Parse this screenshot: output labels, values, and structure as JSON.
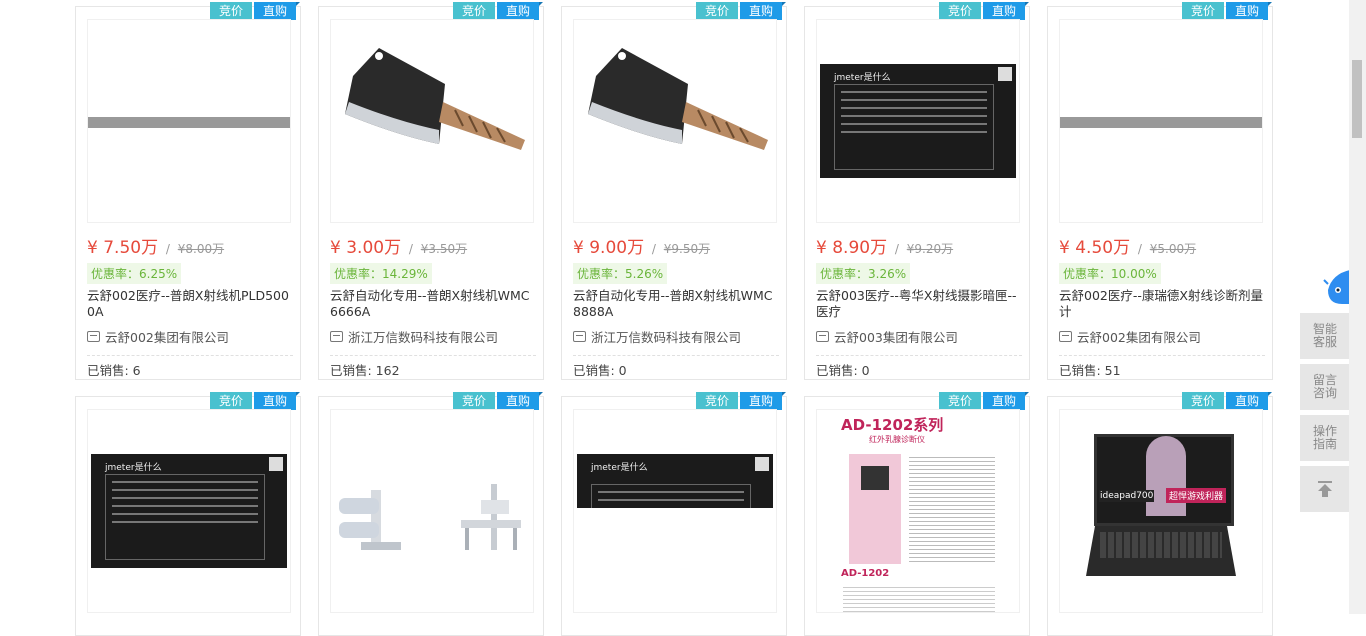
{
  "badges": {
    "bid": "竞价",
    "buy": "直购"
  },
  "labels": {
    "sold_prefix": "已销售: "
  },
  "products": [
    {
      "price": "¥ 7.50万",
      "orig_sep": " / ",
      "orig": "¥8.00万",
      "discount": "优惠率：6.25%",
      "title": "云舒002医疗--普朗X射线机PLD5000A",
      "company": "云舒002集团有限公司",
      "sold": "已销售: 6",
      "image": "gray-placeholder"
    },
    {
      "price": "¥ 3.00万",
      "orig_sep": " / ",
      "orig": "¥3.50万",
      "discount": "优惠率：14.29%",
      "title": "云舒自动化专用--普朗X射线机WMC6666A",
      "company": "浙江万信数码科技有限公司",
      "sold": "已销售: 162",
      "image": "cleaver-knife"
    },
    {
      "price": "¥ 9.00万",
      "orig_sep": " / ",
      "orig": "¥9.50万",
      "discount": "优惠率：5.26%",
      "title": "云舒自动化专用--普朗X射线机WMC8888A",
      "company": "浙江万信数码科技有限公司",
      "sold": "已销售: 0",
      "image": "cleaver-knife"
    },
    {
      "price": "¥ 8.90万",
      "orig_sep": " / ",
      "orig": "¥9.20万",
      "discount": "优惠率：3.26%",
      "title": "云舒003医疗--粤华X射线摄影暗匣--医疗",
      "company": "云舒003集团有限公司",
      "sold": "已销售: 0",
      "image": "jmeter-slide"
    },
    {
      "price": "¥ 4.50万",
      "orig_sep": " / ",
      "orig": "¥5.00万",
      "discount": "优惠率：10.00%",
      "title": "云舒002医疗--康瑞德X射线诊断剂量计",
      "company": "云舒002集团有限公司",
      "sold": "已销售: 51",
      "image": "gray-placeholder"
    }
  ],
  "row2_images": [
    "jmeter-slide",
    "xray-machine",
    "jmeter-slide-partial",
    "ad1202-brochure",
    "ideapad-laptop"
  ],
  "slide": {
    "title": "jmeter是什么"
  },
  "ad": {
    "title": "AD-1202系列",
    "sub": "红外乳腺诊断仪",
    "model": "AD-1202"
  },
  "laptop": {
    "text": "ideapad700",
    "tag": "超悍游戏利器"
  },
  "sidetool": {
    "service": "智能客服",
    "message": "留言咨询",
    "guide": "操作指南",
    "top": "回到顶部"
  }
}
